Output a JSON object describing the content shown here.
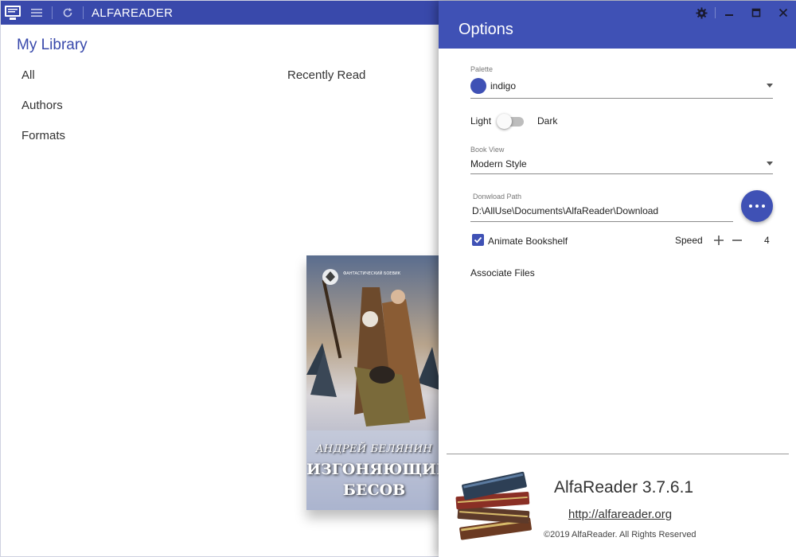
{
  "app": {
    "title": "ALFAREADER",
    "accent": "#3949ab",
    "icons": [
      "app-logo-icon",
      "hamburger-menu-icon",
      "refresh-icon"
    ]
  },
  "library": {
    "heading": "My Library",
    "nav": [
      "All",
      "Authors",
      "Formats"
    ],
    "recent_heading": "Recently Read",
    "book": {
      "series": "ФАНТАСТИЧЕСКИЙ БОЕВИК",
      "author": "АНДРЕЙ БЕЛЯНИН",
      "title_line1": "ИЗГОНЯЮЩИЙ",
      "title_line2": "БЕСОВ"
    }
  },
  "options": {
    "title": "Options",
    "window_icons": [
      "gear-icon",
      "minimize-icon",
      "maximize-icon",
      "close-icon"
    ],
    "palette": {
      "label": "Palette",
      "value": "indigo",
      "swatch_color": "#3f51b5"
    },
    "theme": {
      "light_label": "Light",
      "dark_label": "Dark",
      "dark_enabled": false
    },
    "book_view": {
      "label": "Book View",
      "value": "Modern Style"
    },
    "download_path": {
      "label": "Donwload Path",
      "value": "D:\\AllUse\\Documents\\AlfaReader\\Download"
    },
    "animate": {
      "label": "Animate Bookshelf",
      "checked": true
    },
    "speed": {
      "label": "Speed",
      "value": "4"
    },
    "associate_files": "Associate Files"
  },
  "about": {
    "name": "AlfaReader 3.7.6.1",
    "url": "http://alfareader.org",
    "copyright": "©2019 AlfaReader. All Rights Reserved"
  }
}
